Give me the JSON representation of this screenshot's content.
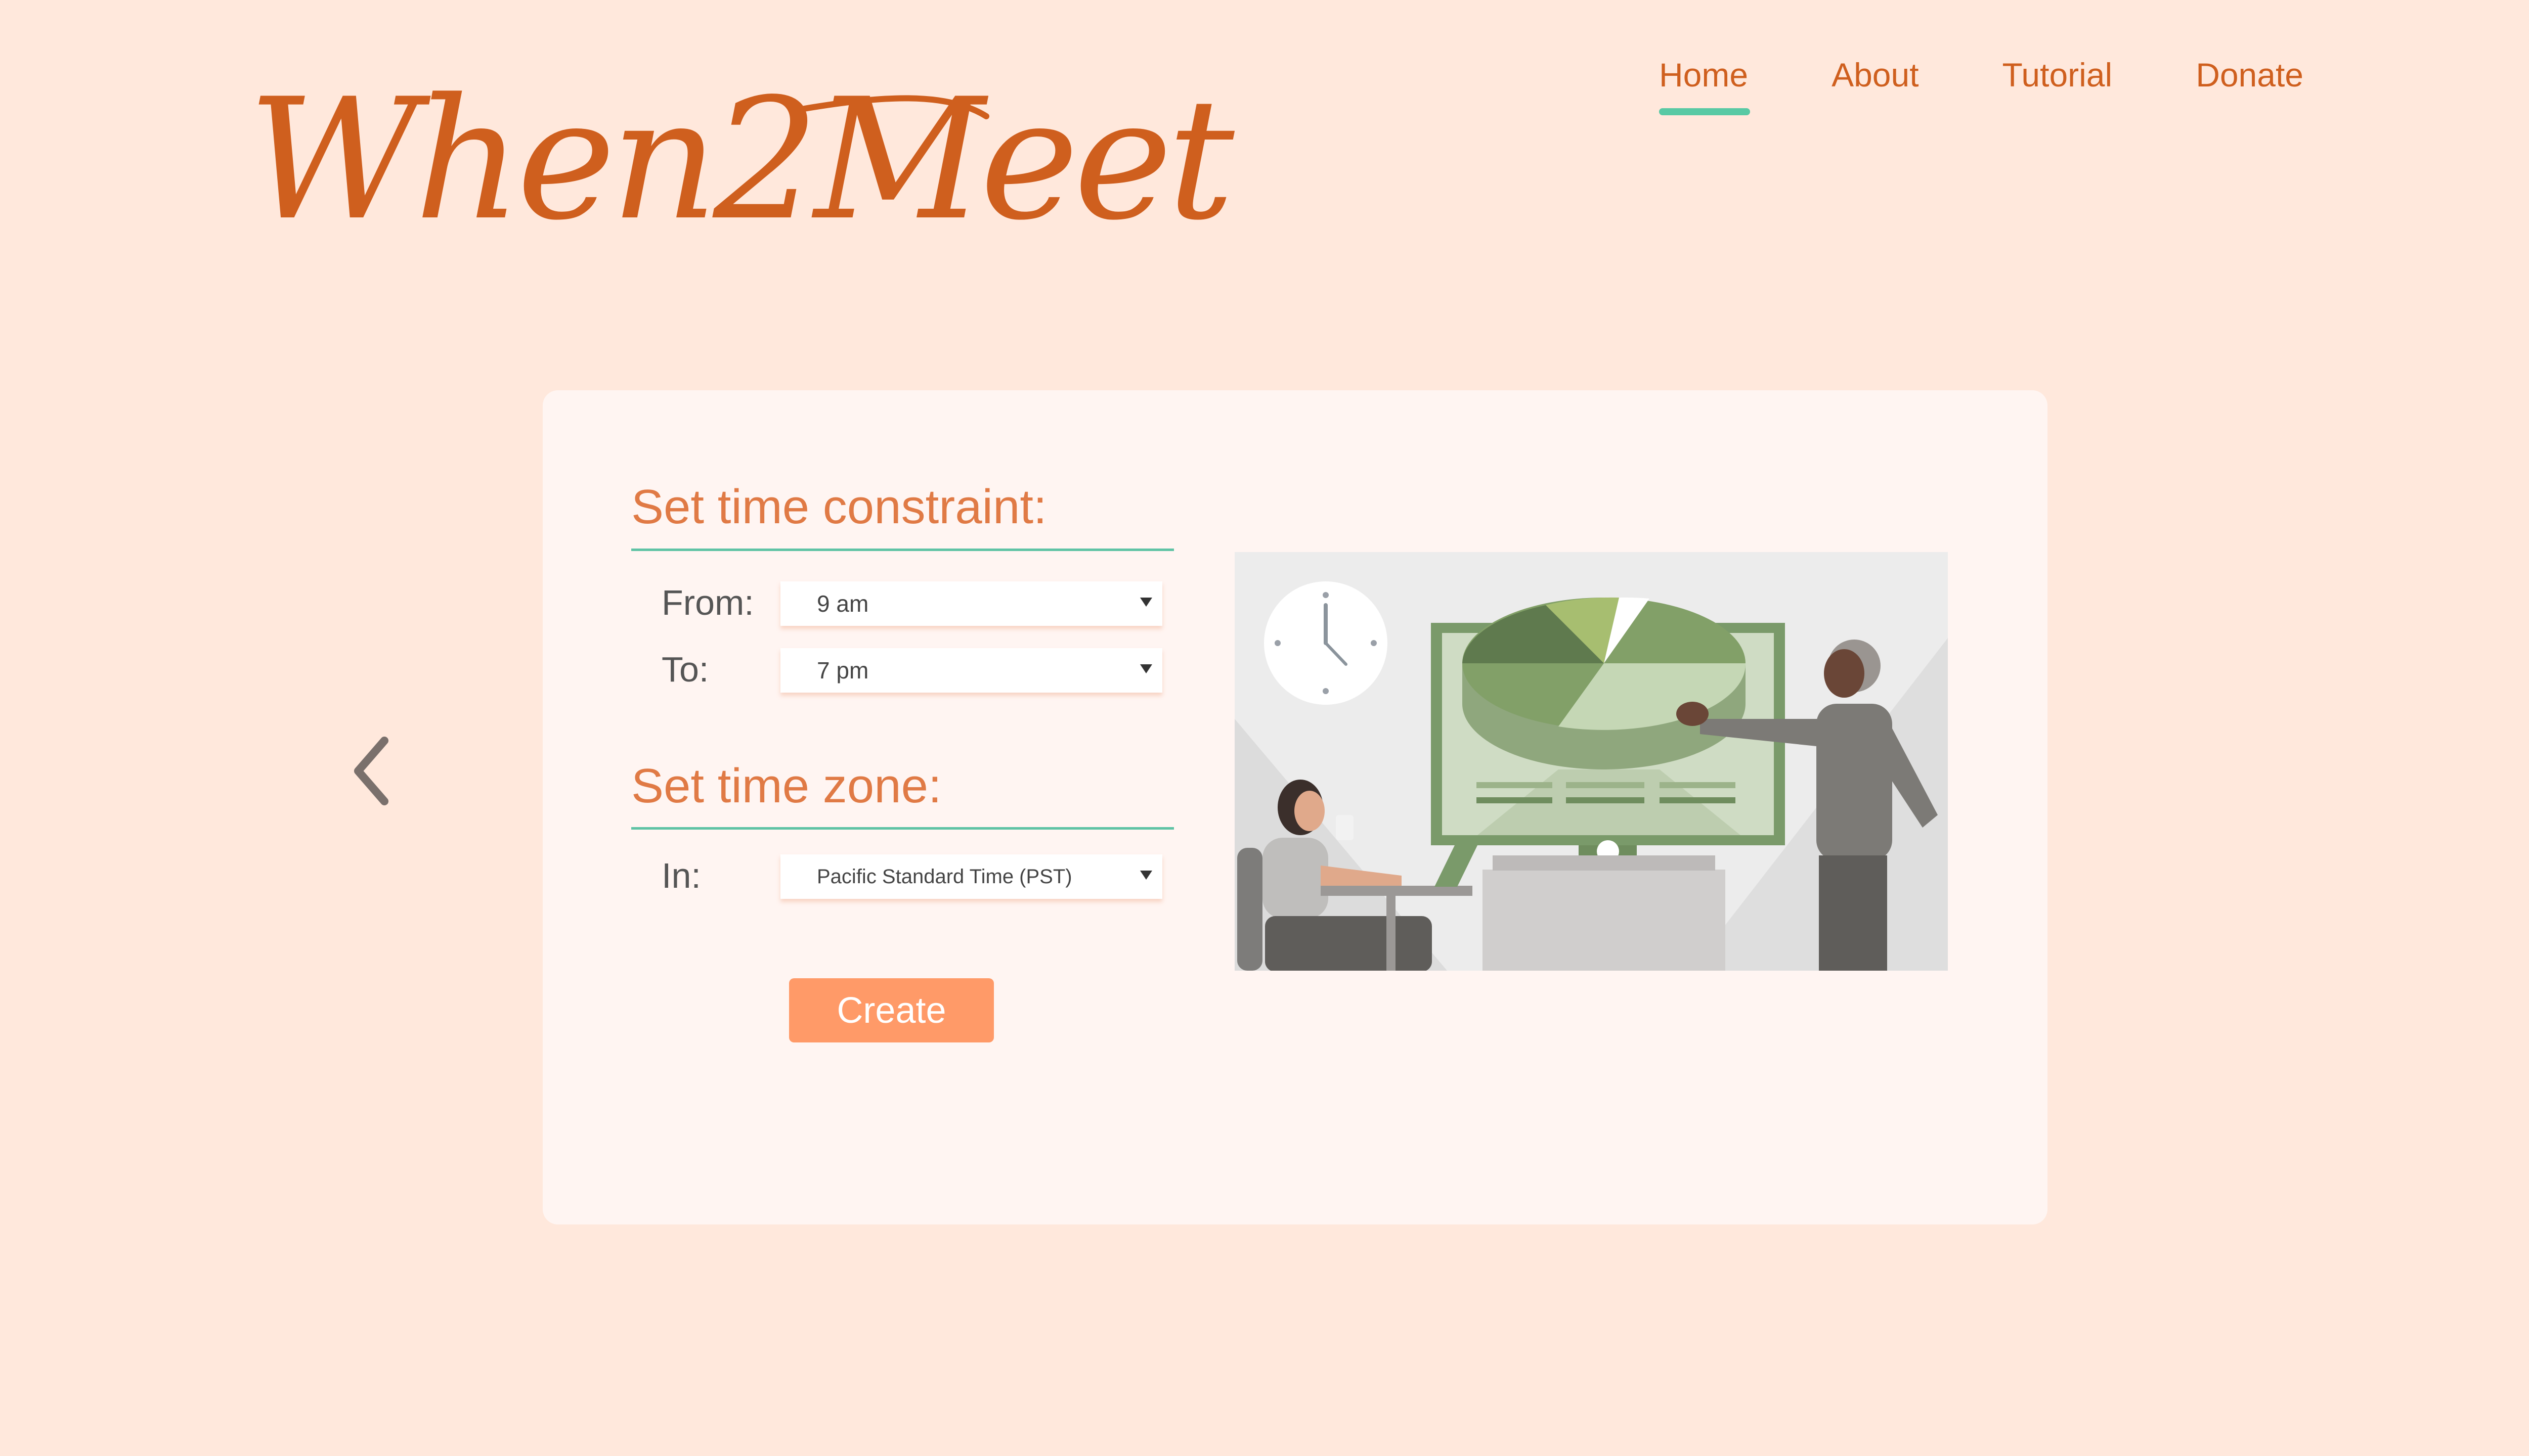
{
  "logo": {
    "text": "When2Meet"
  },
  "nav": {
    "items": [
      {
        "label": "Home",
        "active": true
      },
      {
        "label": "About",
        "active": false
      },
      {
        "label": "Tutorial",
        "active": false
      },
      {
        "label": "Donate",
        "active": false
      }
    ]
  },
  "back_icon": "chevron-left-icon",
  "form": {
    "time_constraint_title": "Set time constraint:",
    "from_label": "From:",
    "from_value": "9 am",
    "to_label": "To:",
    "to_value": "7 pm",
    "time_zone_title": "Set time zone:",
    "in_label": "In:",
    "zone_value": "Pacific Standard Time (PST)",
    "create_label": "Create"
  },
  "colors": {
    "background": "#ffe8dc",
    "card": "#fff5f2",
    "brand": "#cf5f1e",
    "title": "#e07a45",
    "accent_line": "#5fc3a5",
    "button": "#ff9a68"
  }
}
